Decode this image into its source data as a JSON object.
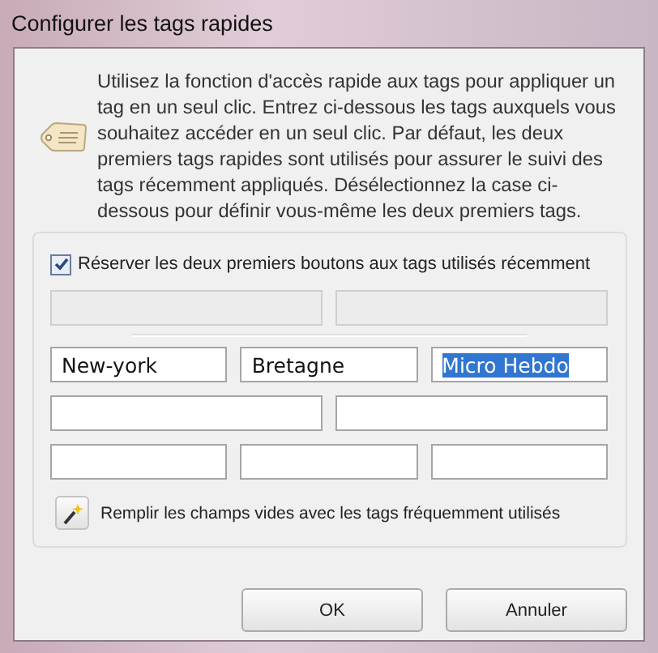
{
  "window": {
    "title": "Configurer les tags rapides"
  },
  "description": "Utilisez la fonction d'accès rapide aux tags pour appliquer un tag en un seul clic. Entrez ci-dessous les tags auxquels vous souhaitez accéder en un seul clic. Par défaut, les deux premiers tags rapides sont utilisés pour assurer le suivi des tags récemment appliqués. Désélectionnez la case ci-dessous pour définir vous-même les deux premiers tags.",
  "reserve_checkbox": {
    "label": "Réserver les deux premiers boutons aux tags utilisés récemment",
    "checked": true
  },
  "recent_fields": [
    {
      "disabled": true
    },
    {
      "disabled": true
    }
  ],
  "field_rows": [
    [
      {
        "value": "New-york",
        "text_selected": false
      },
      {
        "value": "Bretagne",
        "text_selected": false
      },
      {
        "value": "Micro Hebdo",
        "text_selected": true
      }
    ],
    [
      {},
      {}
    ],
    [
      {},
      {},
      {}
    ]
  ],
  "fill_action": {
    "label": "Remplir les champs vides avec les tags fréquemment utilisés"
  },
  "buttons": [
    "OK",
    "Annuler"
  ]
}
